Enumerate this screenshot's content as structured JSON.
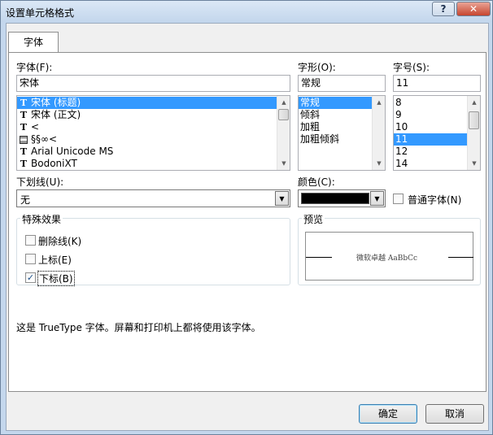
{
  "window": {
    "title": "设置单元格格式",
    "help_glyph": "?",
    "close_glyph": "✕"
  },
  "tabs": [
    {
      "label": "字体"
    }
  ],
  "font": {
    "label": "字体(F):",
    "value": "宋体",
    "items": [
      {
        "label": "宋体 (标题)",
        "icon": "truetype-icon",
        "selected": true
      },
      {
        "label": "宋体 (正文)",
        "icon": "truetype-icon",
        "selected": false
      },
      {
        "label": "<",
        "icon": "truetype-icon",
        "selected": false
      },
      {
        "label": "§§∞<",
        "icon": "printer-font-icon",
        "selected": false
      },
      {
        "label": "Arial Unicode MS",
        "icon": "truetype-icon",
        "selected": false
      },
      {
        "label": "BodoniXT",
        "icon": "truetype-icon",
        "selected": false
      }
    ]
  },
  "style": {
    "label": "字形(O):",
    "value": "常规",
    "items": [
      {
        "label": "常规",
        "selected": true
      },
      {
        "label": "倾斜",
        "selected": false
      },
      {
        "label": "加粗",
        "selected": false
      },
      {
        "label": "加粗倾斜",
        "selected": false
      }
    ]
  },
  "size": {
    "label": "字号(S):",
    "value": "11",
    "items": [
      {
        "label": "8",
        "selected": false
      },
      {
        "label": "9",
        "selected": false
      },
      {
        "label": "10",
        "selected": false
      },
      {
        "label": "11",
        "selected": true
      },
      {
        "label": "12",
        "selected": false
      },
      {
        "label": "14",
        "selected": false
      }
    ]
  },
  "underline": {
    "label": "下划线(U):",
    "value": "无"
  },
  "color": {
    "label": "颜色(C):",
    "value": "#000000"
  },
  "normal_font": {
    "label": "普通字体(N)",
    "checked": false
  },
  "effects": {
    "title": "特殊效果",
    "strikethrough": {
      "label": "删除线(K)",
      "checked": false
    },
    "superscript": {
      "label": "上标(E)",
      "checked": false
    },
    "subscript": {
      "label": "下标(B)",
      "checked": true
    }
  },
  "preview": {
    "title": "预览",
    "sample": "微软卓越  AaBbCc"
  },
  "info_text": "这是 TrueType 字体。屏幕和打印机上都将使用该字体。",
  "buttons": {
    "ok": "确定",
    "cancel": "取消"
  },
  "glyphs": {
    "check": "✓",
    "arrow_up": "▲",
    "arrow_down": "▼",
    "truetype": "T"
  }
}
